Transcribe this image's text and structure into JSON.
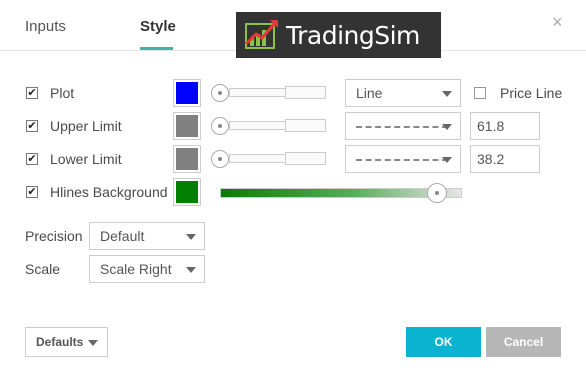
{
  "tabs": {
    "inputs": "Inputs",
    "style": "Style"
  },
  "logo": {
    "text": "TradingSim"
  },
  "close": "×",
  "rows": {
    "plot": {
      "checked": true,
      "label": "Plot",
      "color": "#0000ff",
      "style": "Line",
      "price_line_label": "Price Line",
      "price_line_checked": false
    },
    "upper": {
      "checked": true,
      "label": "Upper Limit",
      "color": "#808080",
      "value": "61.8"
    },
    "lower": {
      "checked": true,
      "label": "Lower Limit",
      "color": "#808080",
      "value": "38.2"
    },
    "hlines": {
      "checked": true,
      "label": "Hlines Background",
      "color": "#008000"
    }
  },
  "precision": {
    "label": "Precision",
    "value": "Default"
  },
  "scale": {
    "label": "Scale",
    "value": "Scale Right"
  },
  "buttons": {
    "defaults": "Defaults",
    "ok": "OK",
    "cancel": "Cancel"
  }
}
